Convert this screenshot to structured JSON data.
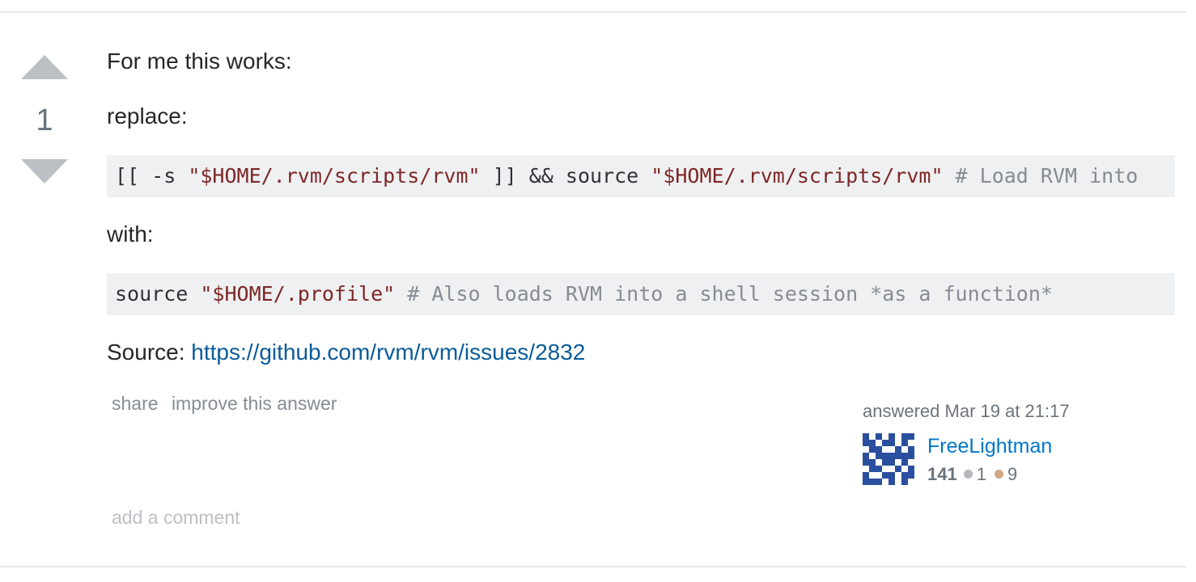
{
  "vote": {
    "count": "1"
  },
  "post": {
    "p1": "For me this works:",
    "p2": "replace:",
    "code1": {
      "part1": "[[ -s ",
      "part2": "\"$HOME/.rvm/scripts/rvm\"",
      "part3": " ]] && source ",
      "part4": "\"$HOME/.rvm/scripts/rvm\"",
      "part5": " # Load RVM into"
    },
    "p3": "with:",
    "code2": {
      "part1": "source ",
      "part2": "\"$HOME/.profile\"",
      "part3": " # Also loads RVM into a shell session *as a function*"
    },
    "source_label": "Source: ",
    "source_link": "https://github.com/rvm/rvm/issues/2832"
  },
  "menu": {
    "share": "share",
    "improve": "improve this answer"
  },
  "signature": {
    "action_time": "answered Mar 19 at 21:17",
    "user_name": "FreeLightman",
    "reputation": "141",
    "silver": "1",
    "bronze": "9",
    "avatar_color": "#2a4f9e"
  },
  "comments": {
    "add_label": "add a comment"
  },
  "colors": {
    "string": "#7d2727",
    "comment": "#858c93",
    "link": "#0a5b99",
    "user_link": "#0077cc",
    "vote_arrow": "#bbc0c4"
  }
}
